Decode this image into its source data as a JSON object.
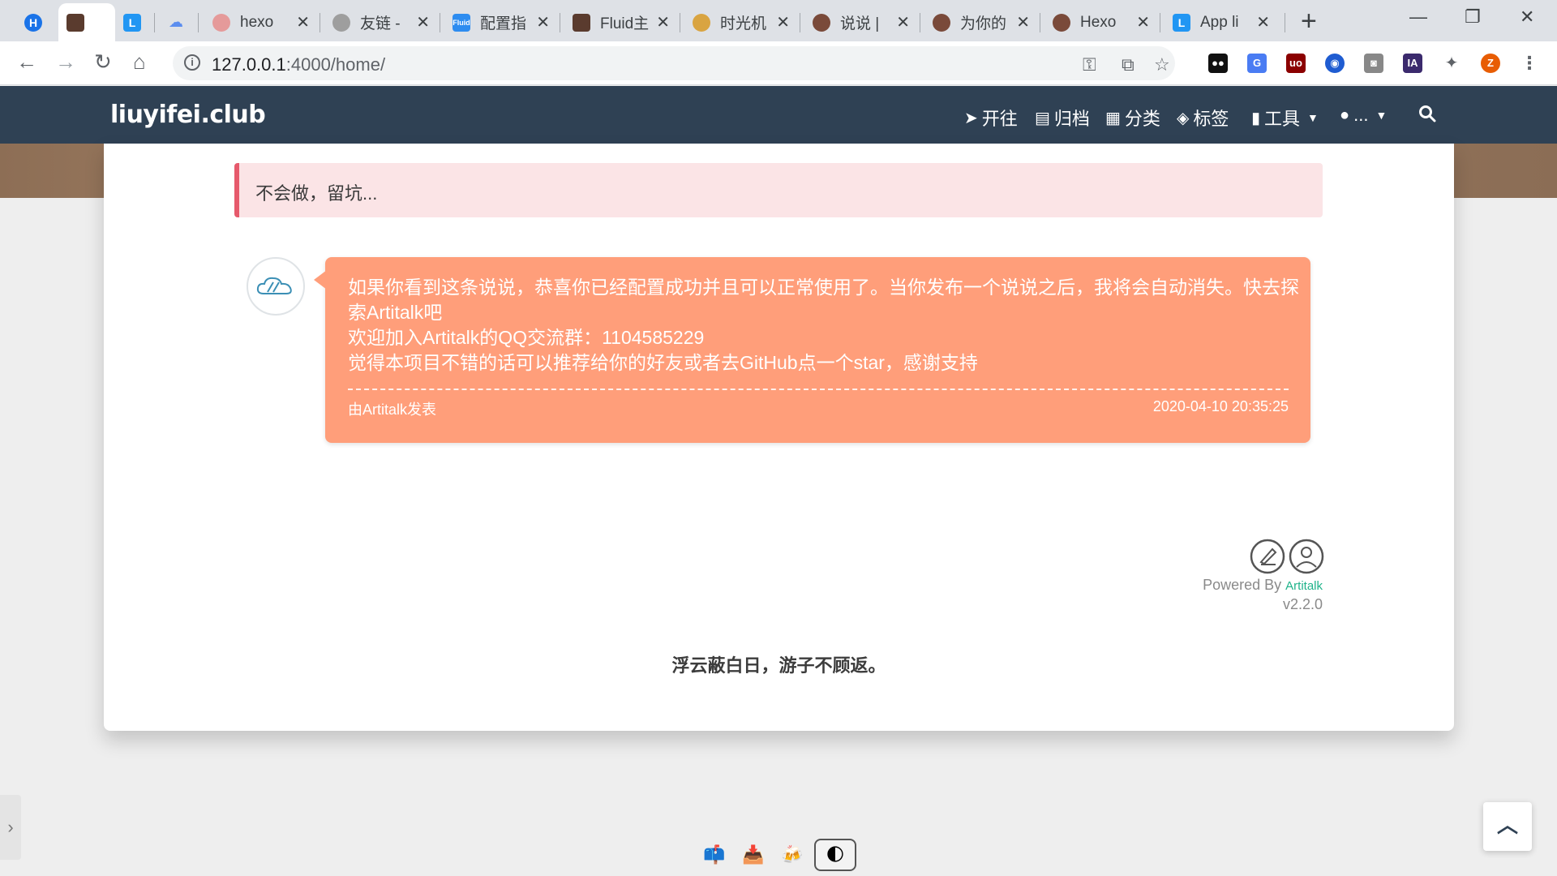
{
  "browser": {
    "tabs": [
      {
        "title": "",
        "icon": "h-badge-icon",
        "color": "#1a73e8"
      },
      {
        "title": "",
        "icon": "avatar-girl-icon",
        "color": "#5a3b2e",
        "active": true
      },
      {
        "title": "",
        "icon": "l-badge-icon",
        "color": "#2196f3"
      },
      {
        "title": "",
        "icon": "cloud-icon",
        "color": "#5b8def"
      },
      {
        "title": "hexo",
        "icon": "anime-girl-icon",
        "color": "#e59a9a"
      },
      {
        "title": "友链 -",
        "icon": "hamster-icon",
        "color": "#888888"
      },
      {
        "title": "配置指",
        "icon": "fluid-icon",
        "color": "#2d8cf0"
      },
      {
        "title": "Fluid主",
        "icon": "avatar-girl-icon",
        "color": "#5a3b2e"
      },
      {
        "title": "时光机",
        "icon": "bread-icon",
        "color": "#d9a441"
      },
      {
        "title": "说说 |",
        "icon": "dog-avatar-icon",
        "color": "#7a4a3a"
      },
      {
        "title": "为你的",
        "icon": "dog-avatar-icon",
        "color": "#7a4a3a"
      },
      {
        "title": "Hexo",
        "icon": "dog-avatar-icon",
        "color": "#7a4a3a"
      },
      {
        "title": "App li",
        "icon": "l-badge-icon",
        "color": "#2196f3"
      }
    ],
    "url_host": "127.0.0.1",
    "url_path": ":4000/home/"
  },
  "site": {
    "brand": "liuyifei.club",
    "nav": [
      {
        "label": "开往",
        "icon": "paper-plane-icon"
      },
      {
        "label": "归档",
        "icon": "archive-icon"
      },
      {
        "label": "分类",
        "icon": "th-large-icon"
      },
      {
        "label": "标签",
        "icon": "tags-icon"
      },
      {
        "label": "工具",
        "icon": "bar-chart-icon",
        "dropdown": true
      },
      {
        "label": "...",
        "icon": "user-icon",
        "dropdown": true
      }
    ]
  },
  "notice": "不会做，留坑...",
  "talk": {
    "lines": [
      "如果你看到这条说说，恭喜你已经配置成功并且可以正常使用了。当你发布一个说说之后，我将会自动消失。快去探",
      "索Artitalk吧",
      "欢迎加入Artitalk的QQ交流群：1104585229",
      "觉得本项目不错的话可以推荐给你的好友或者去GitHub点一个star，感谢支持"
    ],
    "source": "由Artitalk发表",
    "time": "2020-04-10 20:35:25",
    "bubble_color": "#ff9e7a"
  },
  "powered": {
    "prefix": "Powered By ",
    "brand": "Artitalk",
    "version": "v2.2.0"
  },
  "motto": "浮云蔽白日，游子不顾返。",
  "colors": {
    "navbar": "#2f4154",
    "notice_border": "#e65a6c",
    "notice_bg": "#fbe4e6"
  }
}
